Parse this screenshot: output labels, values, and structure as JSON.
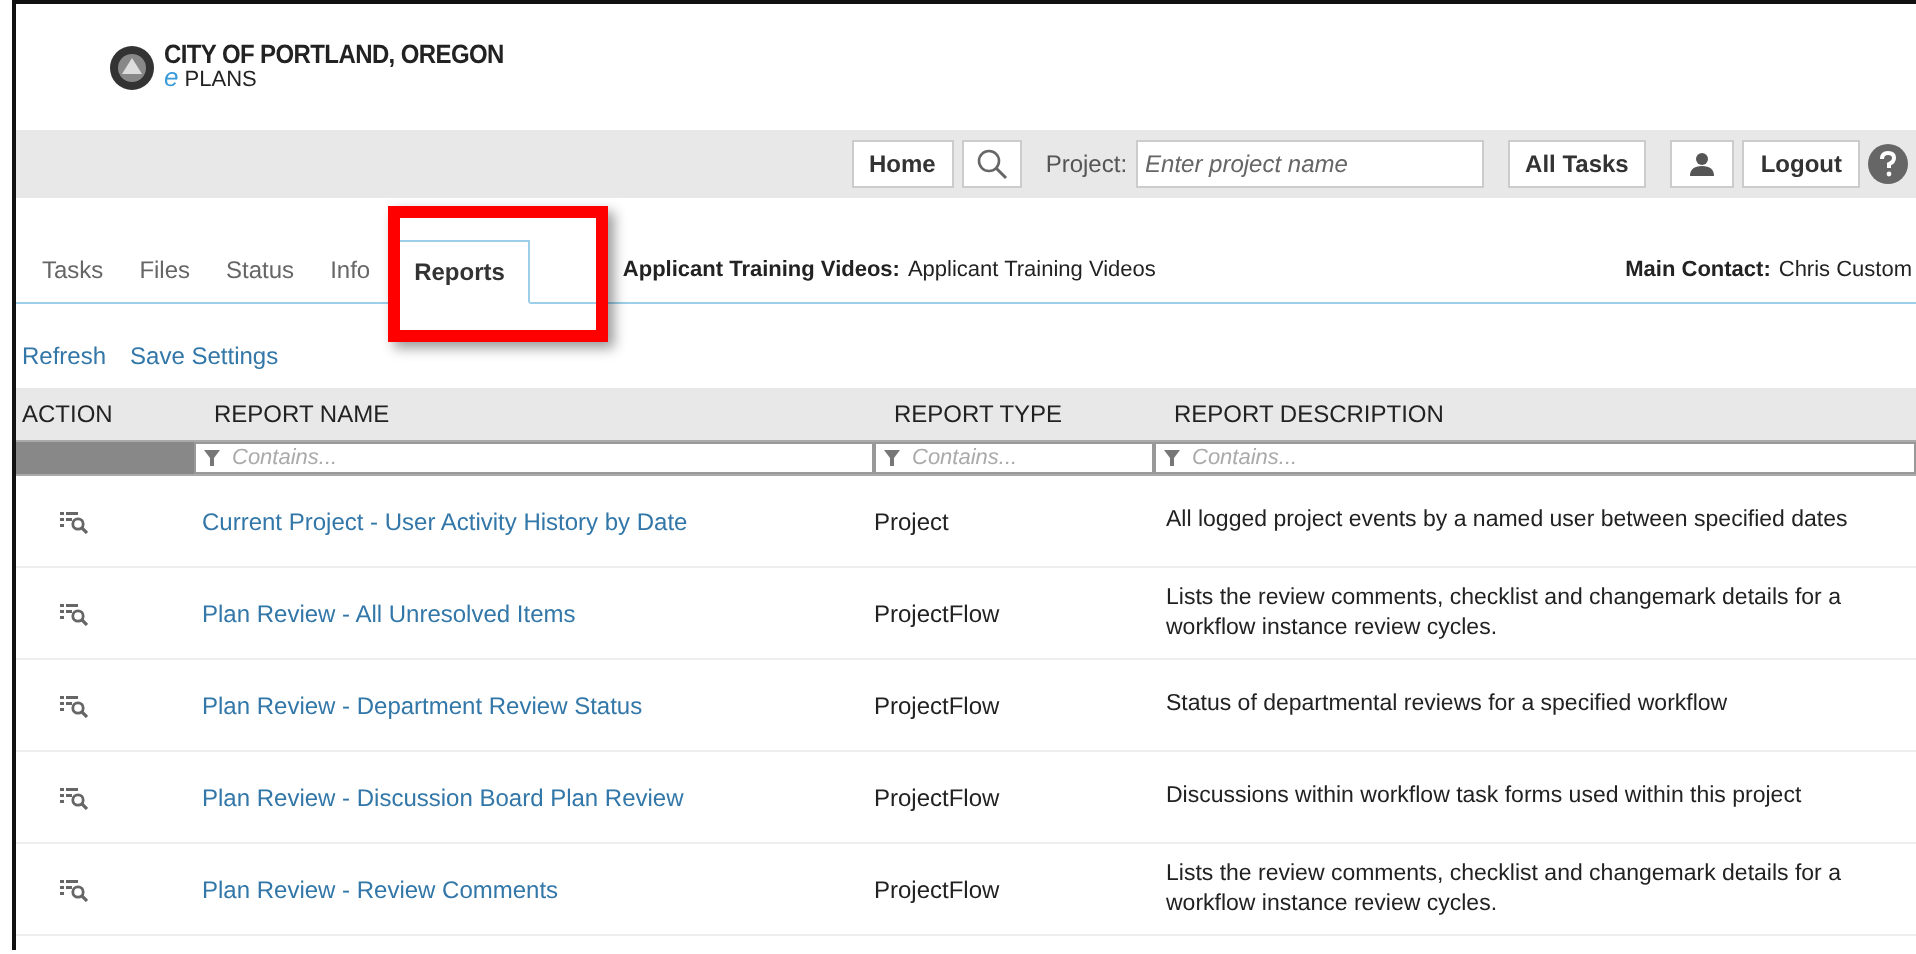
{
  "header": {
    "logo_line1": "CITY OF PORTLAND, OREGON",
    "logo_e": "e",
    "logo_line2": "PLANS"
  },
  "toolbar": {
    "home": "Home",
    "project_label": "Project:",
    "project_placeholder": "Enter project name",
    "all_tasks": "All Tasks",
    "logout": "Logout"
  },
  "tabs": [
    {
      "label": "Tasks",
      "selected": false
    },
    {
      "label": "Files",
      "selected": false
    },
    {
      "label": "Status",
      "selected": false
    },
    {
      "label": "Info",
      "selected": false
    },
    {
      "label": "Reports",
      "selected": true
    }
  ],
  "project_info": {
    "label": "Applicant Training Videos:",
    "value": "Applicant Training Videos",
    "contact_label": "Main Contact:",
    "contact_value": "Chris Custom"
  },
  "actions": [
    "Refresh",
    "Save Settings"
  ],
  "table": {
    "columns": [
      "ACTION",
      "REPORT NAME",
      "REPORT TYPE",
      "REPORT DESCRIPTION"
    ],
    "filters": [
      {
        "placeholder": "Contains..."
      },
      {
        "placeholder": "Contains..."
      },
      {
        "placeholder": "Contains..."
      }
    ],
    "rows": [
      {
        "name": "Current Project - User Activity History by Date",
        "type": "Project",
        "description": "All logged project events by a named user between specified dates"
      },
      {
        "name": "Plan Review - All Unresolved Items",
        "type": "ProjectFlow",
        "description": "Lists the review comments, checklist and changemark details for a workflow instance review cycles."
      },
      {
        "name": "Plan Review - Department Review Status",
        "type": "ProjectFlow",
        "description": "Status of departmental reviews for a specified workflow"
      },
      {
        "name": "Plan Review - Discussion Board Plan Review",
        "type": "ProjectFlow",
        "description": "Discussions within workflow task forms used within this project"
      },
      {
        "name": "Plan Review - Review Comments",
        "type": "ProjectFlow",
        "description": "Lists the review comments, checklist and changemark details for a workflow instance review cycles."
      }
    ]
  }
}
